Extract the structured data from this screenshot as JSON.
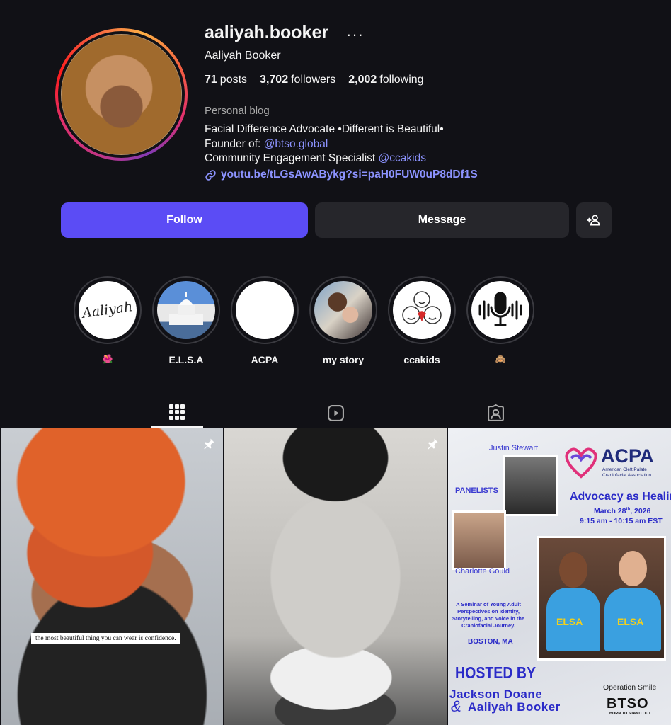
{
  "profile": {
    "username": "aaliyah.booker",
    "full_name": "Aaliyah Booker",
    "category": "Personal blog",
    "bio_line1": "Facial Difference Advocate •Different is Beautiful•",
    "bio_line2_prefix": "Founder of: ",
    "bio_line2_mention": "@btso.global",
    "bio_line3_prefix": "Community Engagement Specialist ",
    "bio_line3_mention": "@ccakids",
    "link": "youtu.be/tLGsAwABykg?si=paH0FUW0uP8dDf1S"
  },
  "stats": {
    "posts_count": "71",
    "posts_label": "posts",
    "followers_count": "3,702",
    "followers_label": "followers",
    "following_count": "2,002",
    "following_label": "following"
  },
  "actions": {
    "follow": "Follow",
    "message": "Message"
  },
  "highlights": [
    {
      "label": "🌺",
      "cover_text": "Aaliyah"
    },
    {
      "label": "E.L.S.A"
    },
    {
      "label": "ACPA"
    },
    {
      "label": "my story"
    },
    {
      "label": "ccakids"
    },
    {
      "label": "🙈"
    }
  ],
  "tabs": [
    "posts-grid",
    "reels",
    "tagged"
  ],
  "posts": {
    "post1_caption": "the most beautiful thing you can wear is confidence.",
    "flyer": {
      "name_top": "Justin Stewart",
      "panelists": "PANELISTS",
      "org_short": "ACPA",
      "org_line1": "American Cleft Palate",
      "org_line2": "Craniofacial Association",
      "title": "Advocacy as Healing",
      "date_prefix": "March 28",
      "date_suffix": "th",
      "date_year": ", 2026",
      "time": "9:15 am - 10:15 am EST",
      "name_bottom": "Charlotte Gould",
      "desc_line1": "A Seminar of Young Adult",
      "desc_line2": "Perspectives on Identity,",
      "desc_line3": "Storytelling, and Voice in the",
      "desc_line4": "Craniofacial Journey.",
      "location": "BOSTON, MA",
      "hosted_by": "HOSTED BY",
      "host1": "Jackson Doane",
      "host2_amp": "&",
      "host2": "Aaliyah Booker",
      "sponsor1": "Operation Smile",
      "sponsor2": "BTSO",
      "sponsor2_tag": "BORN TO STAND OUT",
      "shirt_text": "ELSA"
    }
  },
  "colors": {
    "background": "#111116",
    "follow_button": "#5b4cf5",
    "secondary_button": "#26262b",
    "mention_link": "#8c93ff"
  }
}
